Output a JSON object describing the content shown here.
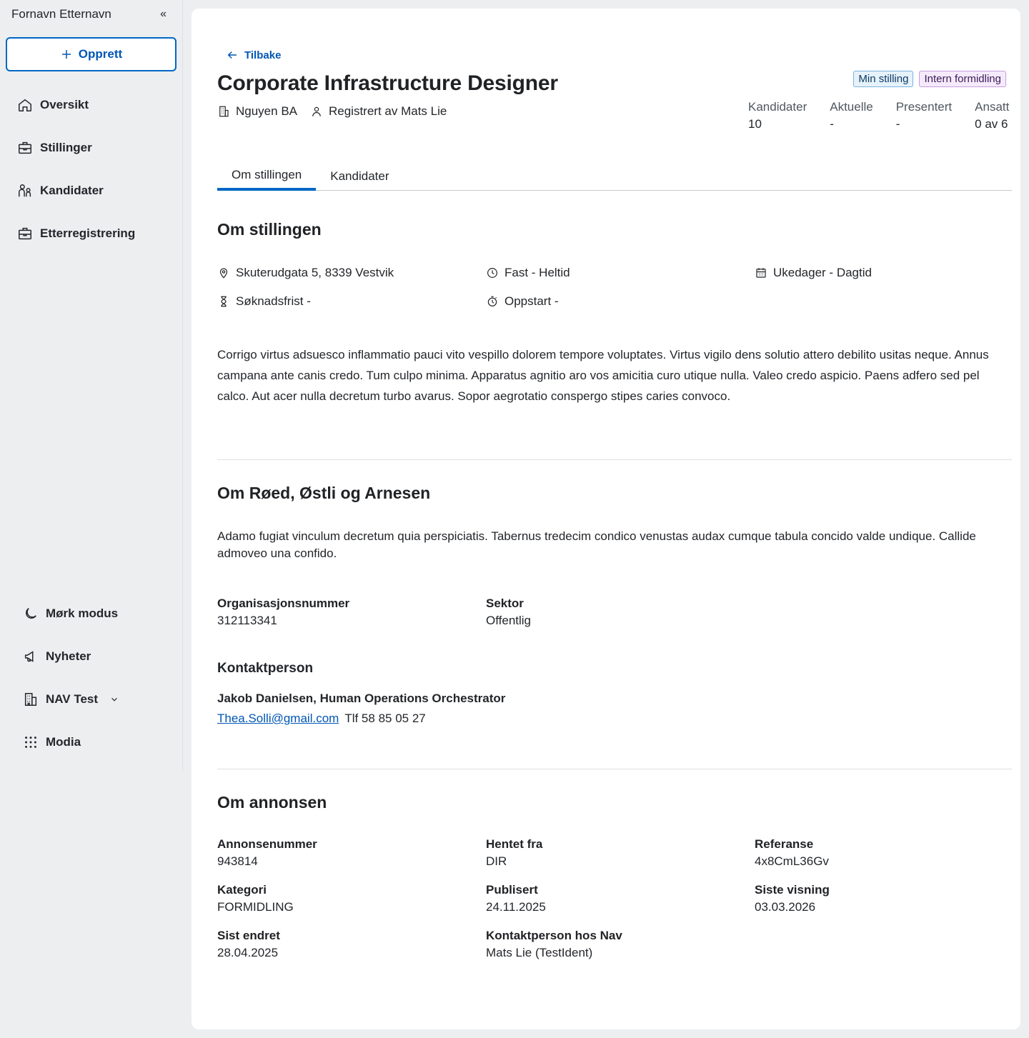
{
  "sidebar": {
    "user_name": "Fornavn Etternavn",
    "create_label": "Opprett",
    "items": [
      {
        "label": "Oversikt",
        "icon": "home-icon"
      },
      {
        "label": "Stillinger",
        "icon": "briefcase-icon"
      },
      {
        "label": "Kandidater",
        "icon": "people-icon"
      },
      {
        "label": "Etterregistrering",
        "icon": "briefcase-icon"
      }
    ],
    "bottom": [
      {
        "label": "Mørk modus",
        "icon": "moon-icon"
      },
      {
        "label": "Nyheter",
        "icon": "megaphone-icon"
      },
      {
        "label": "NAV Test",
        "icon": "buildings-icon"
      },
      {
        "label": "Modia",
        "icon": "grid-icon"
      }
    ]
  },
  "header": {
    "back_label": "Tilbake",
    "title": "Corporate Infrastructure Designer",
    "employer": "Nguyen BA",
    "registered_by": "Registrert av Mats Lie",
    "tags": [
      "Min stilling",
      "Intern formidling"
    ],
    "stats": [
      {
        "label": "Kandidater",
        "value": "10"
      },
      {
        "label": "Aktuelle",
        "value": "-"
      },
      {
        "label": "Presentert",
        "value": "-"
      },
      {
        "label": "Ansatt",
        "value": "0 av 6"
      }
    ]
  },
  "tabs": [
    "Om stillingen",
    "Kandidater"
  ],
  "about_position": {
    "heading": "Om stillingen",
    "address": "Skuterudgata 5, 8339 Vestvik",
    "employment": "Fast - Heltid",
    "schedule": "Ukedager - Dagtid",
    "deadline": "Søknadsfrist -",
    "start": "Oppstart -",
    "description": "Corrigo virtus adsuesco inflammatio pauci vito vespillo dolorem tempore voluptates. Virtus vigilo dens solutio attero debilito usitas neque. Annus campana ante canis credo. Tum culpo minima. Apparatus agnitio aro vos amicitia curo utique nulla. Valeo credo aspicio. Paens adfero sed pel calco. Aut acer nulla decretum turbo avarus. Sopor aegrotatio conspergo stipes caries convoco."
  },
  "about_employer": {
    "heading": "Om Røed, Østli og Arnesen",
    "description": "Adamo fugiat vinculum decretum quia perspiciatis. Tabernus tredecim condico venustas audax cumque tabula concido valde undique. Callide admoveo una confido.",
    "org_label": "Organisasjonsnummer",
    "org_value": "312113341",
    "sector_label": "Sektor",
    "sector_value": "Offentlig",
    "contact_heading": "Kontaktperson",
    "contact_name": "Jakob Danielsen, Human Operations Orchestrator",
    "contact_email": "Thea.Solli@gmail.com",
    "contact_phone": "Tlf 58 85 05 27"
  },
  "about_ad": {
    "heading": "Om annonsen",
    "fields": [
      {
        "label": "Annonsenummer",
        "value": "943814"
      },
      {
        "label": "Hentet fra",
        "value": "DIR"
      },
      {
        "label": "Referanse",
        "value": "4x8CmL36Gv"
      },
      {
        "label": "Kategori",
        "value": "FORMIDLING"
      },
      {
        "label": "Publisert",
        "value": "24.11.2025"
      },
      {
        "label": "Siste visning",
        "value": "03.03.2026"
      },
      {
        "label": "Sist endret",
        "value": "28.04.2025"
      },
      {
        "label": "Kontaktperson hos Nav",
        "value": "Mats Lie (TestIdent)"
      }
    ]
  }
}
